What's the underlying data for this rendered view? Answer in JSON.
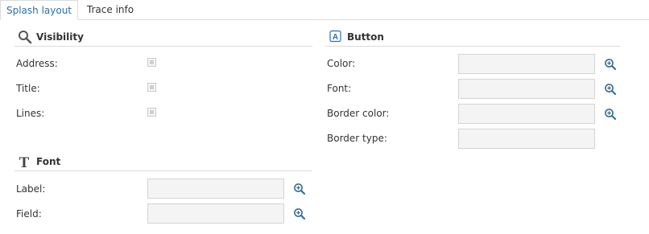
{
  "tabs": [
    {
      "label": "Splash layout",
      "active": true
    },
    {
      "label": "Trace info",
      "active": false
    }
  ],
  "visibility": {
    "title": "Visibility",
    "icon": "search-icon",
    "rows": [
      {
        "label": "Address:",
        "checked": false
      },
      {
        "label": "Title:",
        "checked": false
      },
      {
        "label": "Lines:",
        "checked": false
      }
    ]
  },
  "button": {
    "title": "Button",
    "icon": "button-icon",
    "rows": [
      {
        "label": "Color:",
        "value": "",
        "lookup": true
      },
      {
        "label": "Font:",
        "value": "",
        "lookup": true
      },
      {
        "label": "Border color:",
        "value": "",
        "lookup": true
      },
      {
        "label": "Border type:",
        "value": "",
        "lookup": false
      }
    ]
  },
  "font": {
    "title": "Font",
    "icon": "font-icon",
    "rows": [
      {
        "label": "Label:",
        "value": "",
        "lookup": true
      },
      {
        "label": "Field:",
        "value": "",
        "lookup": true
      }
    ]
  },
  "colors": {
    "accent": "#2f6ea8",
    "zoom_icon": "#3a6e8f"
  }
}
